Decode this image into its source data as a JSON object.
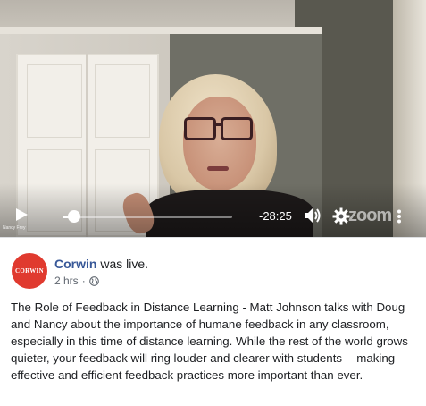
{
  "video": {
    "caption_name": "Nancy Frey",
    "time_remaining": "-28:25",
    "progress": 0.06,
    "watermark": "zoom",
    "icons": [
      "play-icon",
      "volume-icon",
      "settings-gear-icon",
      "more-options-icon"
    ]
  },
  "post": {
    "page_name": "Corwin",
    "action": " was live.",
    "avatar_text": "CORWIN",
    "time_ago": "2 hrs",
    "separator": "·",
    "privacy_icon": "globe-icon",
    "body": "The Role of Feedback in Distance Learning - Matt Johnson talks with Doug and Nancy about the importance of humane feedback in any classroom, especially in this time of distance learning. While the rest of the world grows quieter, your feedback will ring louder and clearer with students -- making effective and efficient feedback practices more important than ever."
  },
  "colors": {
    "brand_link": "#385898",
    "avatar_bg": "#e03a2f",
    "text": "#1c1e21",
    "meta": "#606770"
  }
}
